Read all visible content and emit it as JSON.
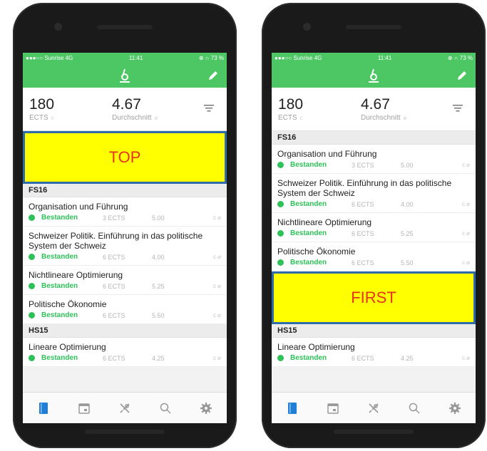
{
  "colors": {
    "accent": "#4cc764",
    "status_green": "#2ec15a",
    "highlight": "#ffff00",
    "highlight_text": "#e8331c",
    "highlight_border": "#2e6ca9"
  },
  "status_bar": {
    "left": "●●●○○ Sunrise  4G",
    "time": "11:41",
    "right": "⊕ ∩ 73 %"
  },
  "summary": {
    "ects_value": "180",
    "ects_label": "ECTS",
    "ects_mini": "c",
    "avg_value": "4.67",
    "avg_label": "Durchschnitt",
    "avg_mini": "⌀"
  },
  "icons": {
    "logo": "logo-icon",
    "edit": "pencil-icon",
    "filter": "filter-icon"
  },
  "left_phone": {
    "banner": "TOP",
    "sec1": "FS16",
    "c1": {
      "title": "Organisation und Führung",
      "status": "Bestanden",
      "ects": "3 ECTS",
      "grade": "5.00",
      "extra": "c ⌀"
    },
    "c2": {
      "title": "Schweizer Politik. Einführung in das politische System der Schweiz",
      "status": "Bestanden",
      "ects": "6 ECTS",
      "grade": "4.00",
      "extra": "c ⌀"
    },
    "c3": {
      "title": "Nichtlineare Optimierung",
      "status": "Bestanden",
      "ects": "6 ECTS",
      "grade": "5.25",
      "extra": "c ⌀"
    },
    "c4": {
      "title": "Politische Ökonomie",
      "status": "Bestanden",
      "ects": "6 ECTS",
      "grade": "5.50",
      "extra": "c ⌀"
    },
    "sec2": "HS15",
    "c5": {
      "title": "Lineare Optimierung",
      "status": "Bestanden",
      "ects": "6 ECTS",
      "grade": "4.25",
      "extra": "c ⌀"
    }
  },
  "right_phone": {
    "sec1": "FS16",
    "c1": {
      "title": "Organisation und Führung",
      "status": "Bestanden",
      "ects": "3 ECTS",
      "grade": "5.00",
      "extra": "c ⌀"
    },
    "c2": {
      "title": "Schweizer Politik. Einführung in das politische System der Schweiz",
      "status": "Bestanden",
      "ects": "6 ECTS",
      "grade": "4.00",
      "extra": "c ⌀"
    },
    "c3": {
      "title": "Nichtlineare Optimierung",
      "status": "Bestanden",
      "ects": "6 ECTS",
      "grade": "5.25",
      "extra": "c ⌀"
    },
    "c4": {
      "title": "Politische Ökonomie",
      "status": "Bestanden",
      "ects": "6 ECTS",
      "grade": "5.50",
      "extra": "c ⌀"
    },
    "banner": "FIRST",
    "sec2": "HS15",
    "c5": {
      "title": "Lineare Optimierung",
      "status": "Bestanden",
      "ects": "6 ECTS",
      "grade": "4.25",
      "extra": "c ⌀"
    }
  },
  "tabs": [
    "book-icon",
    "calendar-icon",
    "cutlery-icon",
    "search-icon",
    "gear-icon"
  ]
}
